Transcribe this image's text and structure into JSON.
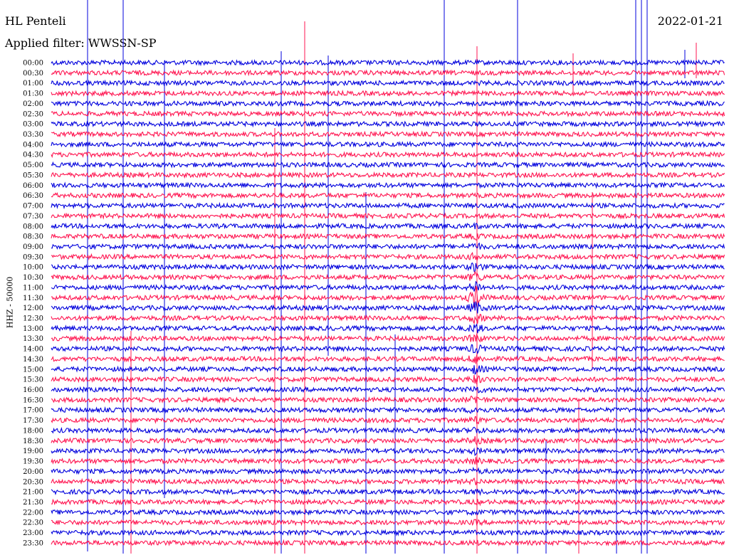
{
  "header": {
    "station": "HL Penteli",
    "filter": "Applied filter: WWSSN-SP",
    "date": "2022-01-21"
  },
  "chart_data": {
    "type": "line",
    "title": "HL Penteli",
    "subtitle": "Applied filter: WWSSN-SP",
    "date": "2022-01-21",
    "ylabel": "HHZ - 50000",
    "rows": [
      "00:00",
      "00:30",
      "01:00",
      "01:30",
      "02:00",
      "02:30",
      "03:00",
      "03:30",
      "04:00",
      "04:30",
      "05:00",
      "05:30",
      "06:00",
      "06:30",
      "07:00",
      "07:30",
      "08:00",
      "08:30",
      "09:00",
      "09:30",
      "10:00",
      "10:30",
      "11:00",
      "11:30",
      "12:00",
      "12:30",
      "13:00",
      "13:30",
      "14:00",
      "14:30",
      "15:00",
      "15:30",
      "16:00",
      "16:30",
      "17:00",
      "17:30",
      "18:00",
      "18:30",
      "19:00",
      "19:30",
      "20:00",
      "20:30",
      "21:00",
      "21:30",
      "22:00",
      "22:30",
      "23:00",
      "23:30"
    ],
    "trace_colors": [
      "#0000dd",
      "#ff1450"
    ],
    "event": {
      "start_row": "08:00",
      "peak_row": "11:30",
      "end_row": "23:30"
    },
    "grid": false
  }
}
